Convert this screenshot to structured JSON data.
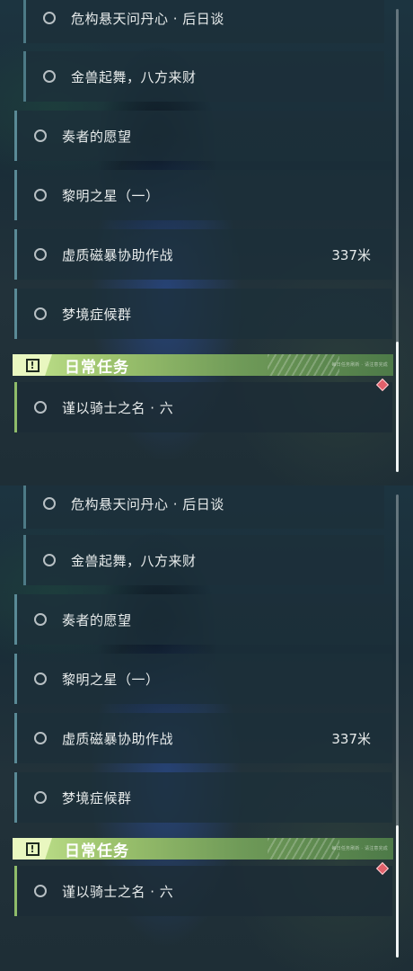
{
  "colors": {
    "accent_daily": "#8fbc6a",
    "main_bar": "#5a8a96",
    "waypoint": "#e0606a"
  },
  "panels": [
    {
      "quests": [
        {
          "label": "危构悬天问丹心 · 后日谈",
          "distance": ""
        },
        {
          "label": "金兽起舞，八方来财",
          "distance": ""
        },
        {
          "label": "奏者的愿望",
          "distance": ""
        },
        {
          "label": "黎明之星（一）",
          "distance": ""
        },
        {
          "label": "虚质磁暴协助作战",
          "distance": "337米"
        },
        {
          "label": "梦境症候群",
          "distance": ""
        }
      ],
      "daily_header": {
        "title": "日常任务",
        "small_text": "每日任务刷新 · 请注意完成"
      },
      "daily_quests": [
        {
          "label": "谨以骑士之名 · 六"
        }
      ]
    },
    {
      "quests": [
        {
          "label": "危构悬天问丹心 · 后日谈",
          "distance": ""
        },
        {
          "label": "金兽起舞，八方来财",
          "distance": ""
        },
        {
          "label": "奏者的愿望",
          "distance": ""
        },
        {
          "label": "黎明之星（一）",
          "distance": ""
        },
        {
          "label": "虚质磁暴协助作战",
          "distance": "337米"
        },
        {
          "label": "梦境症候群",
          "distance": ""
        }
      ],
      "daily_header": {
        "title": "日常任务",
        "small_text": "每日任务刷新 · 请注意完成"
      },
      "daily_quests": [
        {
          "label": "谨以骑士之名 · 六"
        }
      ]
    }
  ],
  "icons": {
    "quest_status": "circle-icon",
    "daily_header": "exclamation-box-icon",
    "tracker": "diamond-marker-icon"
  }
}
